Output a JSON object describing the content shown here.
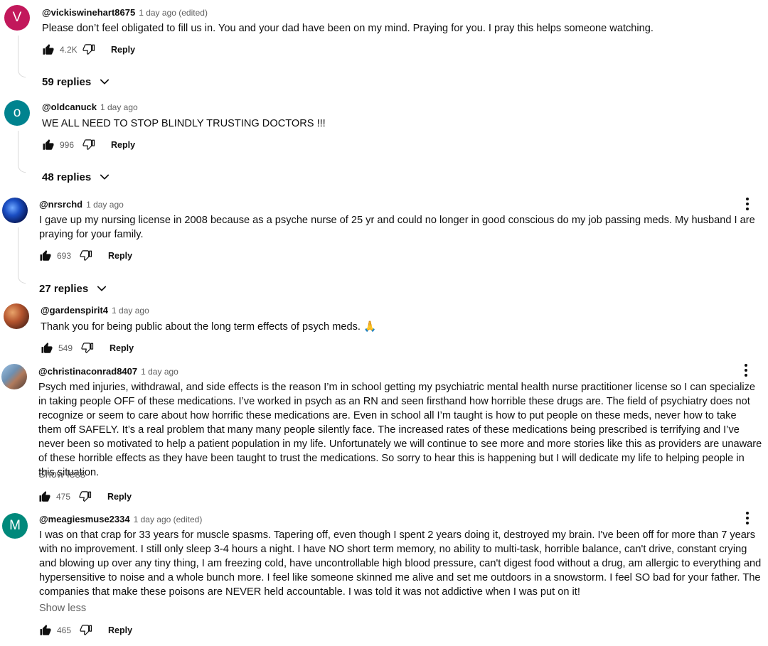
{
  "comments": [
    {
      "avatar_letter": "V",
      "author": "@vickiswinehart8675",
      "time": "1 day ago (edited)",
      "text": "Please don’t feel obligated to fill us in.  You and your dad have been on my mind.  Praying for you. I pray this helps someone watching.",
      "likes": "4.2K",
      "reply_label": "Reply",
      "replies_label": "59 replies"
    },
    {
      "avatar_letter": "o",
      "author": "@oldcanuck",
      "time": "1 day ago",
      "text": "WE ALL NEED TO STOP BLINDLY TRUSTING DOCTORS !!!",
      "likes": "996",
      "reply_label": "Reply",
      "replies_label": "48 replies"
    },
    {
      "author": "@nrsrchd",
      "time": "1 day ago",
      "text": "I gave up my nursing license in 2008 because as a psyche nurse of 25 yr and could no longer in good conscious do my job passing meds.  My husband I are praying for your family.",
      "likes": "693",
      "reply_label": "Reply",
      "replies_label": "27 replies"
    },
    {
      "author": "@gardenspirit4",
      "time": "1 day ago",
      "text": "Thank you for being public about the long term effects of psych meds. 🙏",
      "likes": "549",
      "reply_label": "Reply"
    },
    {
      "author": "@christinaconrad8407",
      "time": "1 day ago",
      "text": "Psych med injuries, withdrawal, and side effects is the reason I’m in school getting my psychiatric mental health nurse practitioner license so I can specialize in taking people OFF of these medications. I’ve worked in psych as an RN and seen firsthand how horrible these drugs are. The field of psychiatry  does not recognize or seem to care about how horrific these medications are. Even in school all I’m taught is how to put people on these meds, never how to take them off SAFELY. It’s a real problem that many many people silently face. The increased rates of these medications being prescribed is terrifying and I’ve never been so motivated to help a patient population in my life. Unfortunately we will continue to see more and more stories like this as providers are unaware of these horrible effects as they have been taught to trust the medications. So sorry to hear this is happening but I will dedicate my life to helping people in this situation.",
      "show_less": "Show less",
      "likes": "475",
      "reply_label": "Reply"
    },
    {
      "avatar_letter": "M",
      "author": "@meagiesmuse2334",
      "time": "1 day ago (edited)",
      "text": "I was on that crap for 33 years for muscle spasms. Tapering off, even though I spent 2 years doing it, destroyed my brain. I've been off for more than 7 years with no improvement. I still only sleep 3-4 hours a night. I have NO short term memory, no ability to multi-task, horrible balance, can't drive, constant crying and blowing up over any tiny thing, I am freezing cold, have uncontrollable high blood pressure, can't digest food without a drug, am allergic to everything and hypersensitive to noise and a whole bunch more. I feel like someone skinned me alive and set me outdoors in a snowstorm. I feel SO bad for your father. The companies that make these poisons are NEVER held accountable. I was told it was not addictive when I was put on it!",
      "show_less": "Show less",
      "likes": "465",
      "reply_label": "Reply"
    }
  ],
  "icons": {
    "like": "thumbs-up-icon",
    "dislike": "thumbs-down-icon",
    "expand": "chevron-down-icon",
    "menu": "more-vert-icon"
  }
}
